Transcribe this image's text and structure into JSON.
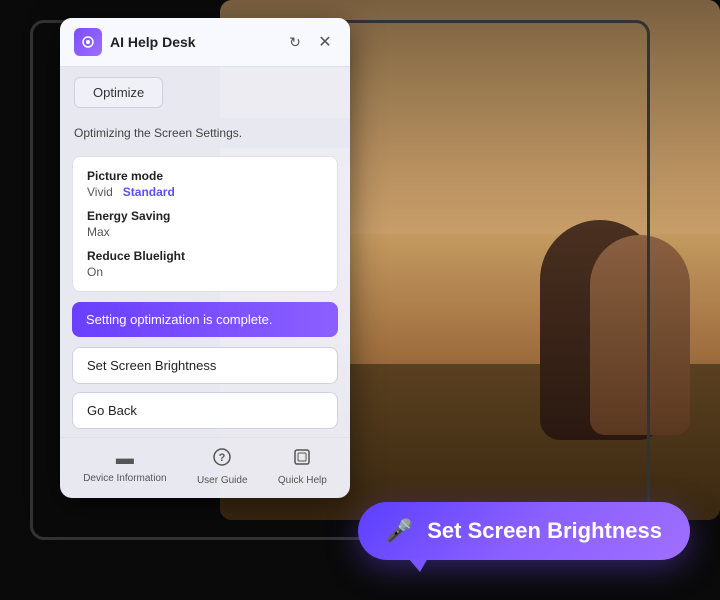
{
  "app": {
    "title": "AI Help Desk",
    "refresh_icon": "↻",
    "close_icon": "✕"
  },
  "toolbar": {
    "optimize_label": "Optimize"
  },
  "status": {
    "message": "Optimizing the Screen Settings."
  },
  "settings": {
    "items": [
      {
        "label": "Picture mode",
        "value": "Vivid",
        "value_active": "Standard"
      },
      {
        "label": "Energy Saving",
        "value": "Max",
        "value_active": null
      },
      {
        "label": "Reduce Bluelight",
        "value": "On",
        "value_active": null
      }
    ]
  },
  "complete_message": "Setting optimization is complete.",
  "actions": {
    "set_brightness": "Set Screen Brightness",
    "go_back": "Go Back"
  },
  "footer": {
    "items": [
      {
        "icon": "▬",
        "label": "Device Information"
      },
      {
        "icon": "?",
        "label": "User Guide"
      },
      {
        "icon": "⊡",
        "label": "Quick Help"
      }
    ]
  },
  "voice_bubble": {
    "mic_icon": "🎤",
    "text": "Set Screen Brightness"
  }
}
